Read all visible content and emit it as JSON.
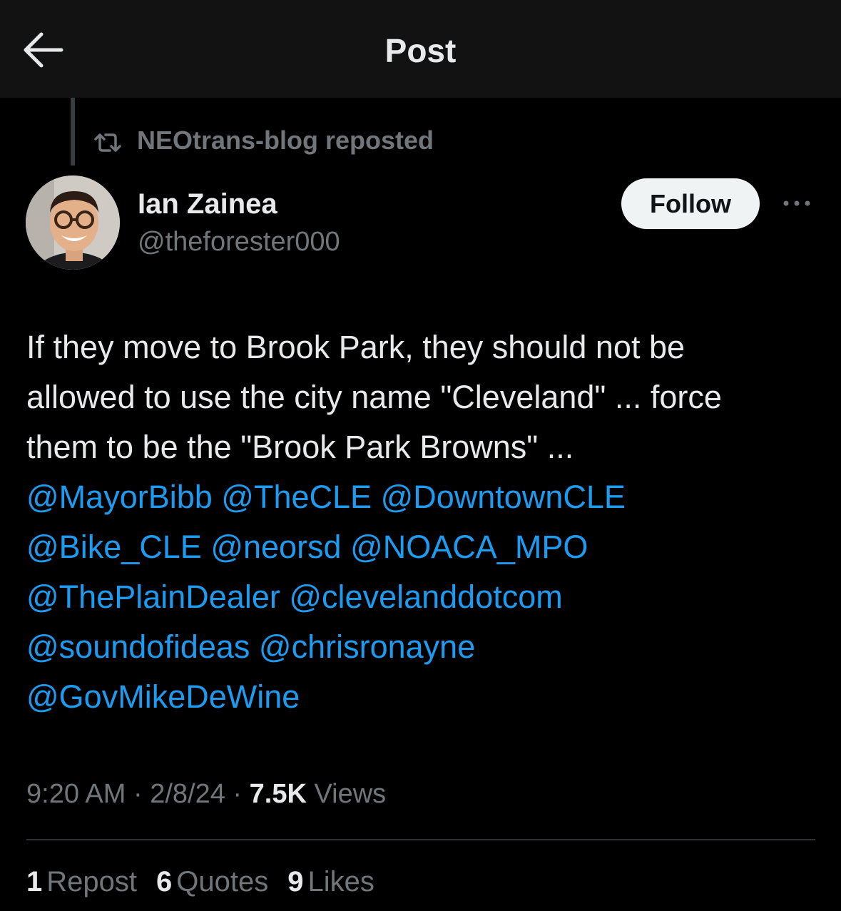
{
  "header": {
    "title": "Post",
    "back_icon": "arrow-left-icon"
  },
  "repost_context": {
    "icon": "repost-icon",
    "text": "NEOtrans-blog reposted"
  },
  "author": {
    "name": "Ian Zainea",
    "handle": "@theforester000",
    "avatar_icon": "user-avatar"
  },
  "follow_button": {
    "label": "Follow"
  },
  "more_menu": {
    "icon": "more-horizontal-icon"
  },
  "post": {
    "text_lines": [
      "If they move to Brook Park, they should not be",
      "allowed to use the city name \"Cleveland\" ... force",
      "them to be the \"Brook Park Browns\" ..."
    ],
    "mentions": [
      [
        "@MayorBibb",
        "@TheCLE",
        "@DowntownCLE"
      ],
      [
        "@Bike_CLE",
        "@neorsd",
        "@NOACA_MPO"
      ],
      [
        "@ThePlainDealer",
        "@clevelanddotcom"
      ],
      [
        "@soundofideas",
        "@chrisronayne"
      ],
      [
        "@GovMikeDeWine"
      ]
    ]
  },
  "meta": {
    "time": "9:20 AM",
    "separator": "·",
    "date": "2/8/24",
    "views_count": "7.5K",
    "views_label": "Views"
  },
  "stats": {
    "reposts_count": "1",
    "reposts_label": "Repost",
    "quotes_count": "6",
    "quotes_label": "Quotes",
    "likes_count": "9",
    "likes_label": "Likes"
  },
  "colors": {
    "background": "#000000",
    "header_bg": "#121212",
    "text": "#e7e9ea",
    "muted": "#71767b",
    "link": "#1d9bf0",
    "button_bg": "#eff3f4"
  }
}
